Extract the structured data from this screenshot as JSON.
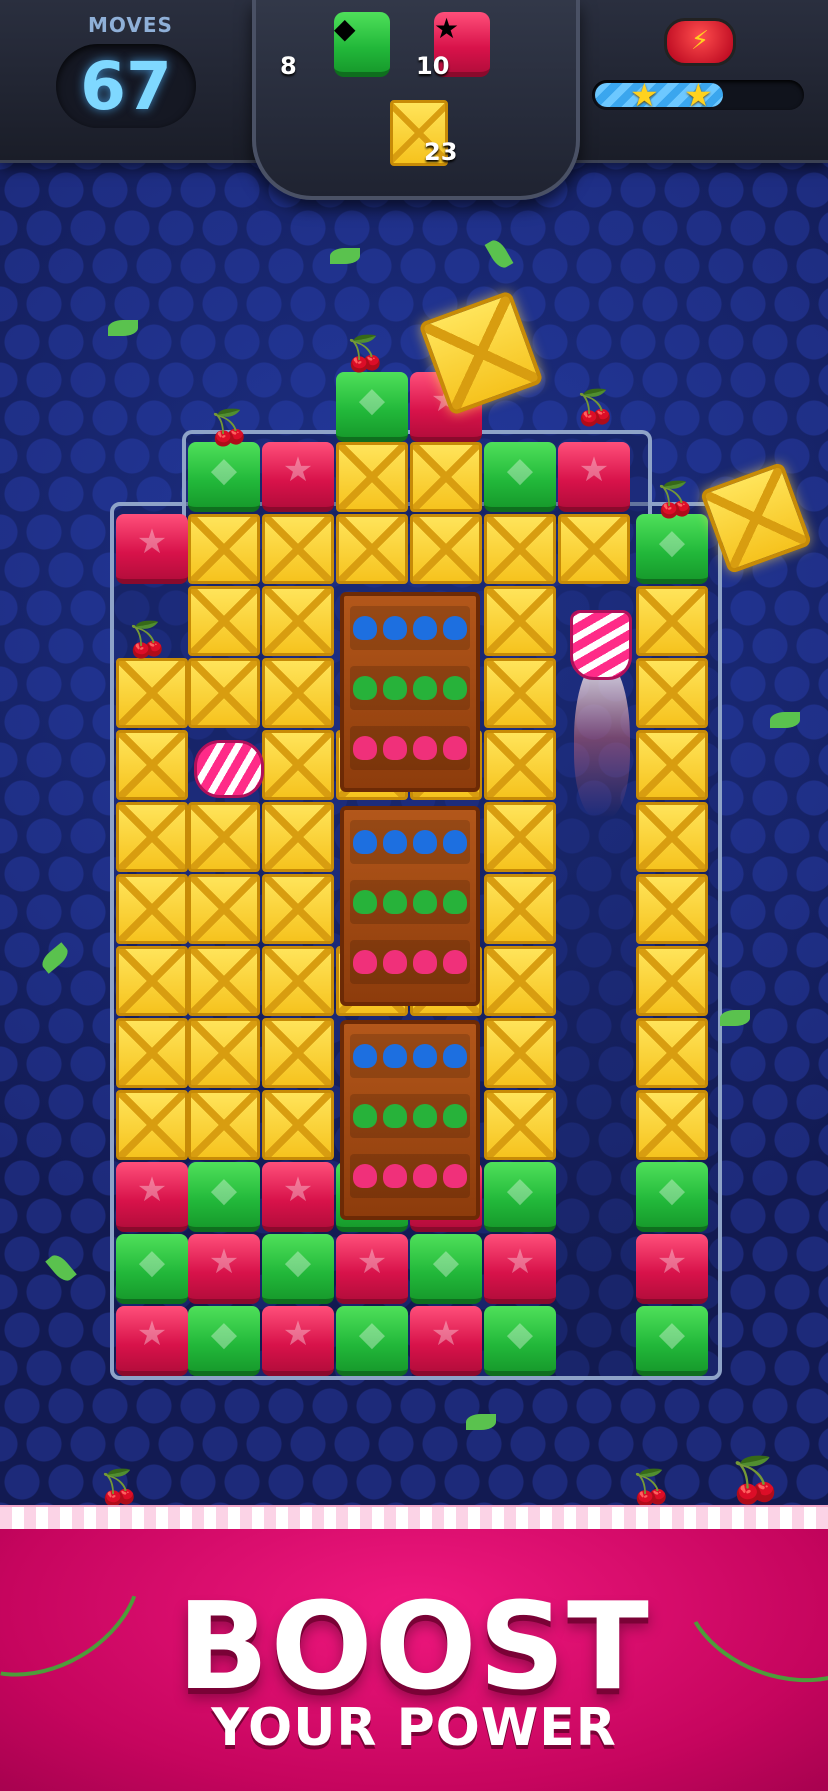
{
  "hud": {
    "moves_label": "MOVES",
    "moves_value": "67",
    "goals": [
      {
        "icon": "green-block-icon",
        "count": "8"
      },
      {
        "icon": "red-block-icon",
        "count": "10"
      },
      {
        "icon": "crate-icon",
        "count": "23"
      }
    ],
    "power_icon": "lightning-icon",
    "progress_fraction": 0.62,
    "stars_earned": 2
  },
  "banner": {
    "line1": "BOOST",
    "line2": "YOUR POWER"
  },
  "colors": {
    "red_block": "#e0174e",
    "green_block": "#2bbf3c",
    "crate": "#f6c31e",
    "banner": "#d30a6c"
  }
}
